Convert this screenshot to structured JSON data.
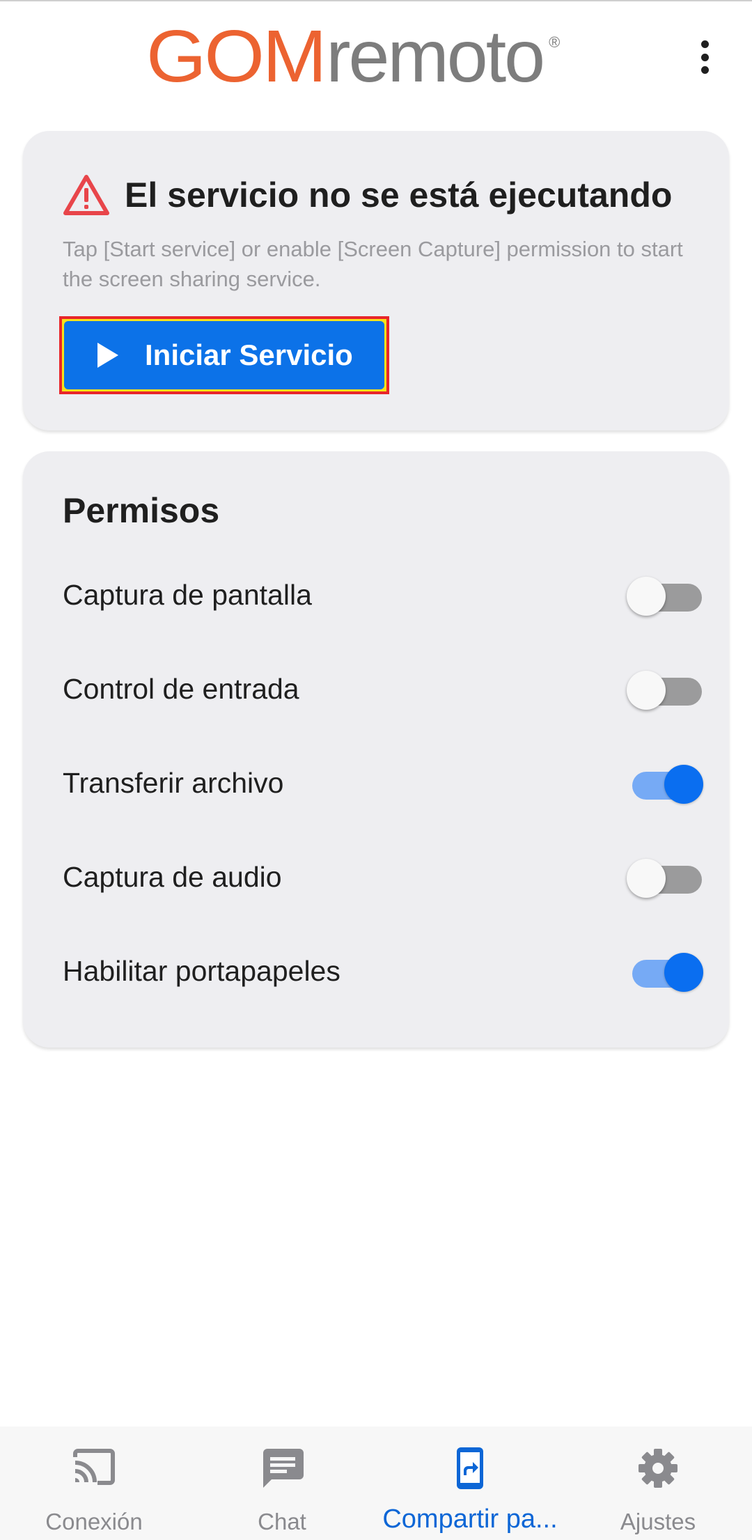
{
  "header": {
    "logo_gom": "GOM",
    "logo_remoto": "remoto",
    "logo_reg": "®",
    "more_icon": "more-vert-icon"
  },
  "service": {
    "title": "El servicio no se está ejecutando",
    "description": "Tap [Start service] or enable [Screen Capture] permission to start the screen sharing service.",
    "start_label": "Iniciar Servicio",
    "warning_color": "#e8454a"
  },
  "permissions": {
    "title": "Permisos",
    "items": [
      {
        "label": "Captura de pantalla",
        "enabled": false
      },
      {
        "label": "Control de entrada",
        "enabled": false
      },
      {
        "label": "Transferir archivo",
        "enabled": true
      },
      {
        "label": "Captura de audio",
        "enabled": false
      },
      {
        "label": "Habilitar portapapeles",
        "enabled": true
      }
    ]
  },
  "bottom_nav": {
    "items": [
      {
        "label": "Conexión",
        "icon": "cast-icon",
        "active": false
      },
      {
        "label": "Chat",
        "icon": "chat-icon",
        "active": false
      },
      {
        "label": "Compartir pa...",
        "icon": "screen-share-icon",
        "active": true
      },
      {
        "label": "Ajustes",
        "icon": "gear-icon",
        "active": false
      }
    ]
  },
  "colors": {
    "accent": "#0c72e8",
    "logo_orange": "#ec6331",
    "logo_gray": "#7d7d7d",
    "nav_active": "#0c66d6",
    "highlight_border": "#e8252a",
    "highlight_fill": "#f5e21a"
  }
}
